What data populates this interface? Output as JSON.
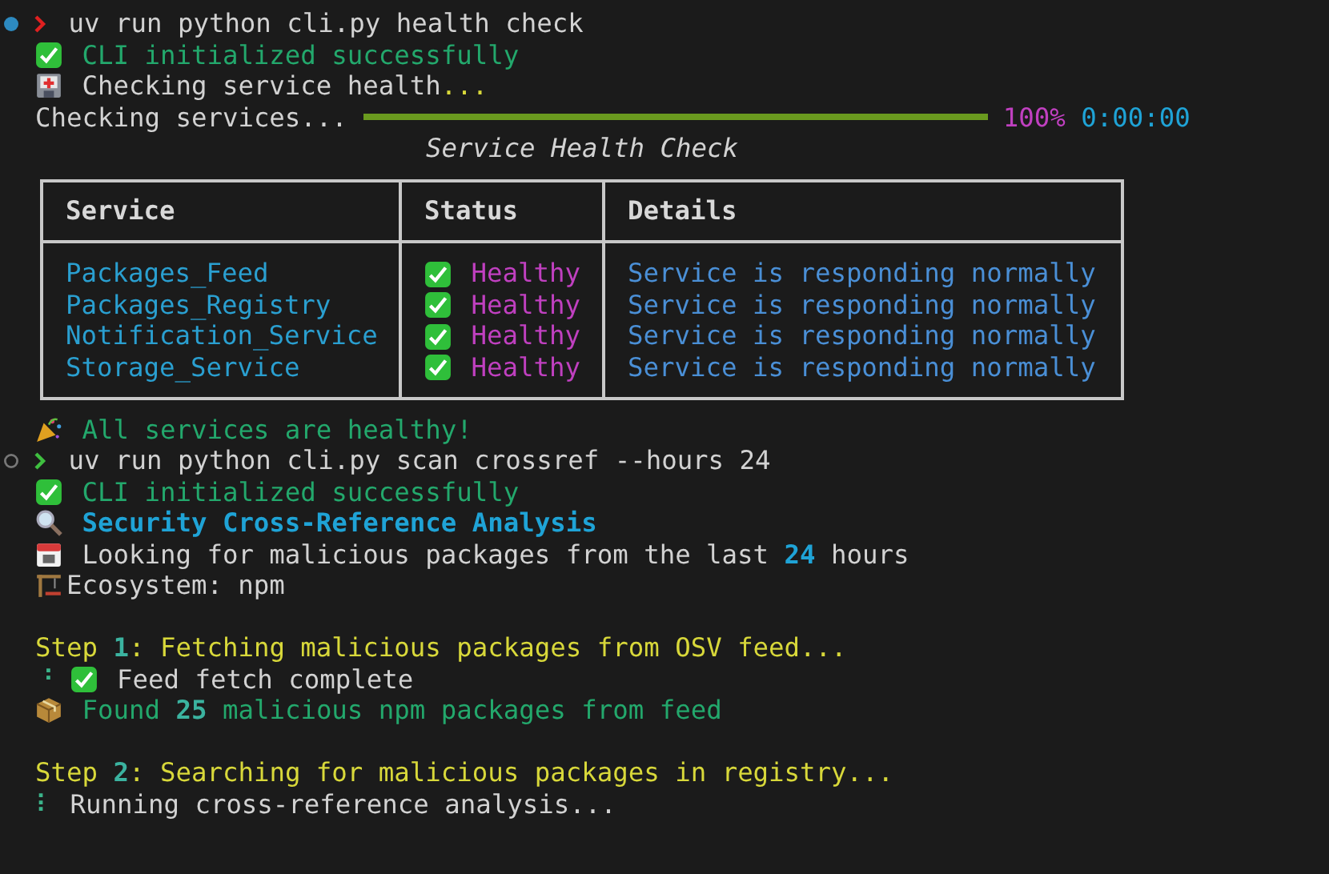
{
  "lines": [
    {
      "kind": "command",
      "marked": true,
      "exit_ok": false,
      "text": "uv run python cli.py health check"
    },
    {
      "kind": "success",
      "segments": [
        {
          "text": "CLI initialized successfully",
          "kind": "success"
        }
      ]
    },
    {
      "kind": "health",
      "segments": [
        {
          "text": "Checking service health",
          "kind": "plain"
        },
        {
          "text": "...",
          "kind": "warning"
        }
      ]
    },
    {
      "kind": "progress",
      "label": "Checking services...",
      "level": 1,
      "percent": "100%",
      "elapsed": "0:00:00"
    },
    {
      "kind": "table",
      "title": "Service Health Check",
      "columns": [
        "Service",
        "Status",
        "Details"
      ],
      "rows": [
        {
          "service": "Packages_Feed",
          "healthy": true,
          "status": "Healthy",
          "details": "Service is responding normally"
        },
        {
          "service": "Packages_Registry",
          "healthy": true,
          "status": "Healthy",
          "details": "Service is responding normally"
        },
        {
          "service": "Notification_Service",
          "healthy": true,
          "status": "Healthy",
          "details": "Service is responding normally"
        },
        {
          "service": "Storage_Service",
          "healthy": true,
          "status": "Healthy",
          "details": "Service is responding normally"
        }
      ]
    },
    {
      "kind": "celebration",
      "segments": [
        {
          "text": "All services are healthy!",
          "kind": "success"
        }
      ]
    },
    {
      "kind": "command",
      "marked": false,
      "exit_ok": true,
      "text": "uv run python cli.py scan crossref --hours 24"
    },
    {
      "kind": "success",
      "segments": [
        {
          "text": "CLI initialized successfully",
          "kind": "success"
        }
      ]
    },
    {
      "kind": "search",
      "segments": [
        {
          "text": "Security Cross-Reference Analysis",
          "kind": "heading"
        }
      ]
    },
    {
      "kind": "date",
      "segments": [
        {
          "text": "Looking for malicious packages from the last ",
          "kind": "plain"
        },
        {
          "text": "24",
          "kind": "heading"
        },
        {
          "text": " hours",
          "kind": "plain"
        }
      ]
    },
    {
      "kind": "ecosystem",
      "segments": [
        {
          "text": "Ecosystem: npm",
          "kind": "plain"
        }
      ]
    },
    {
      "kind": "blank"
    },
    {
      "kind": "plain",
      "segments": [
        {
          "text": "Step ",
          "kind": "warning"
        },
        {
          "text": "1",
          "kind": "number"
        },
        {
          "text": ": Fetching malicious packages from OSV feed...",
          "kind": "warning"
        }
      ]
    },
    {
      "kind": "spinner-success",
      "spinner": "⠘",
      "segments": [
        {
          "text": "Feed fetch complete",
          "kind": "plain"
        }
      ]
    },
    {
      "kind": "package",
      "segments": [
        {
          "text": "Found ",
          "kind": "success"
        },
        {
          "text": "25",
          "kind": "number"
        },
        {
          "text": " malicious npm packages from feed",
          "kind": "success"
        }
      ]
    },
    {
      "kind": "blank"
    },
    {
      "kind": "plain",
      "segments": [
        {
          "text": "Step ",
          "kind": "warning"
        },
        {
          "text": "2",
          "kind": "number"
        },
        {
          "text": ": Searching for malicious packages in registry...",
          "kind": "warning"
        }
      ]
    },
    {
      "kind": "spinner",
      "spinner": "⠇",
      "segments": [
        {
          "text": "Running cross-reference analysis...",
          "kind": "plain"
        }
      ]
    }
  ]
}
